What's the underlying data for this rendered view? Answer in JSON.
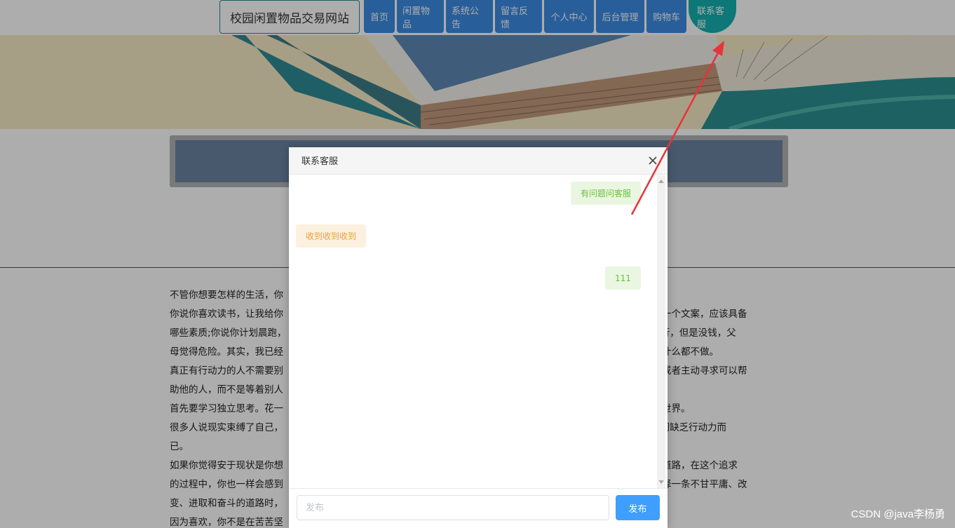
{
  "header": {
    "site_title": "校园闲置物品交易网站",
    "nav": [
      {
        "label": "首页"
      },
      {
        "label": "闲置物品"
      },
      {
        "label": "系统公告"
      },
      {
        "label": "留言反馈"
      },
      {
        "label": "个人中心"
      },
      {
        "label": "后台管理"
      },
      {
        "label": "购物车"
      },
      {
        "label": "联系客服",
        "active": true
      }
    ]
  },
  "article": {
    "lines": [
      "不管你想要怎样的生活，你",
      "你说你喜欢读书，让我给你　　　　　　　　　　　　　　　　　　　　　　　　　　　　　　　　　　　　　　成为一个文案，应该具备",
      "哪些素质;你说你计划晨跑，　　　　　　　　　　　　　　　　　　　　　　　　　　　　　　　　　　　　　长途旅行，但是没钱，父",
      "母觉得危险。其实，我已经　　　　　　　　　　　　　　　　　　　　　　　　　　　　　　　　　　　　　你根本什么都不做。",
      "真正有行动力的人不需要别　　　　　　　　　　　　　　　　　　　　　　　　　　　　　　　　　　　　　去解决或者主动寻求可以帮",
      "助他的人，而不是等着别人",
      "首先要学习独立思考。花一　　　　　　　　　　　　　　　　　　　　　　　　　　　　　　　　　　　　　是环游世界。",
      "很多人说现实束缚了自己，　　　　　　　　　　　　　　　　　　　　　　　　　　　　　　　　　　　　　 只是我们缺乏行动力而",
      "已。",
      "如果你觉得安于现状是你想　　　　　　　　　　　　　　　　　　　　　　　　　　　　　　　　　　　　　奋斗的道路，在这个追求",
      "的过程中，你也一样会感到　　　　　　　　　　　　　　　　　　　　　　　　　　　　　　　　　　　　　想要选择一条不甘平庸、改",
      "变、进取和奋斗的道路时，",
      "因为喜欢，你不是在苦苦坚"
    ]
  },
  "dialog": {
    "title": "联系客服",
    "messages": [
      {
        "from": "me",
        "text": "有问题问客服"
      },
      {
        "from": "cs",
        "text": "收到收到收到"
      },
      {
        "from": "me",
        "text": "111"
      }
    ],
    "input_value": "",
    "input_placeholder": "发布",
    "send_label": "发布"
  },
  "colors": {
    "nav_blue": "#3c8be3",
    "nav_active": "#16b0b0",
    "send_button": "#409eff",
    "annotation_arrow": "#e8333a"
  },
  "watermark": "CSDN @java李杨勇"
}
